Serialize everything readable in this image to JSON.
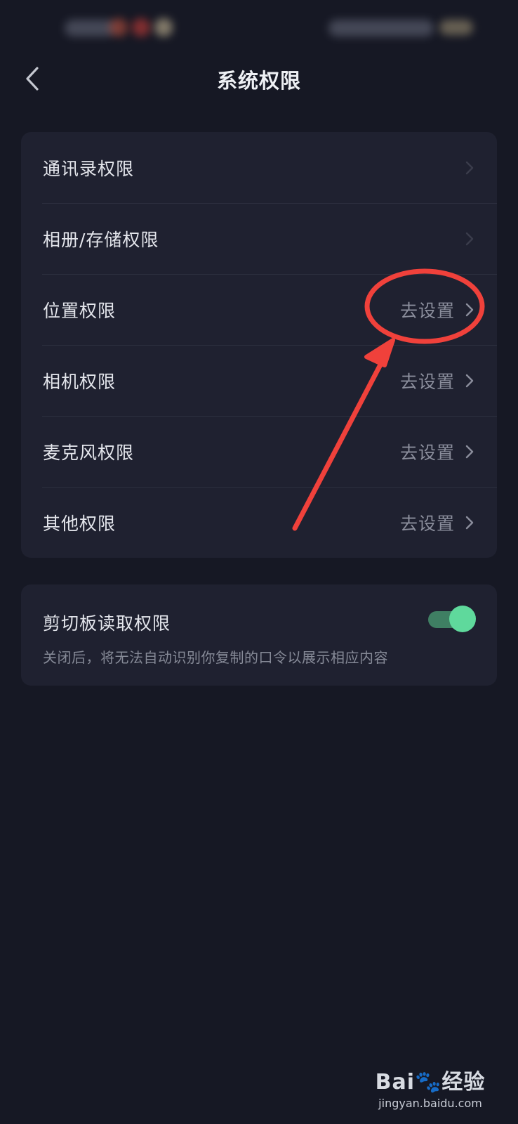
{
  "header": {
    "title": "系统权限",
    "back_icon": "chevron-left-icon"
  },
  "permissions": [
    {
      "label": "通讯录权限",
      "value": ""
    },
    {
      "label": "相册/存储权限",
      "value": ""
    },
    {
      "label": "位置权限",
      "value": "去设置"
    },
    {
      "label": "相机权限",
      "value": "去设置"
    },
    {
      "label": "麦克风权限",
      "value": "去设置"
    },
    {
      "label": "其他权限",
      "value": "去设置"
    }
  ],
  "clipboard": {
    "title": "剪切板读取权限",
    "description": "关闭后，将无法自动识别你复制的口令以展示相应内容",
    "enabled": true
  },
  "colors": {
    "background": "#161824",
    "card": "#1f2130",
    "toggle_on": "#5fd99c",
    "annotation": "#f0413b"
  },
  "watermark": {
    "logo": "Bai🐾经验",
    "url": "jingyan.baidu.com"
  }
}
